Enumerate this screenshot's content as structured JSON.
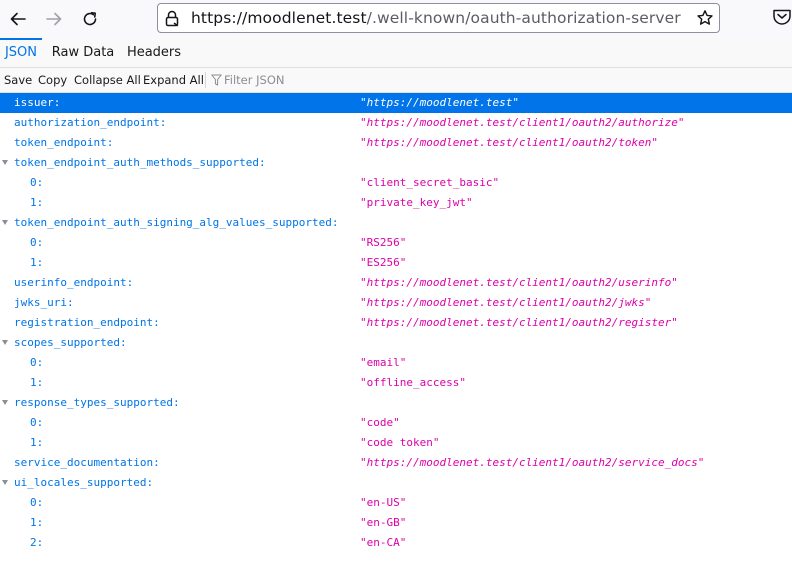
{
  "browser": {
    "url_host": "https://moodlenet.test",
    "url_path": "/.well-known/oauth-authorization-server"
  },
  "tabs": [
    {
      "label": "JSON"
    },
    {
      "label": "Raw Data"
    },
    {
      "label": "Headers"
    }
  ],
  "toolbar": {
    "save_label": "Save",
    "copy_label": "Copy",
    "collapse_label": "Collapse All",
    "expand_label": "Expand All",
    "filter_placeholder": "Filter JSON"
  },
  "rows": [
    {
      "key": "issuer:",
      "value": "\"https://moodlenet.test\"",
      "depth": 0,
      "url": true,
      "selected": true
    },
    {
      "key": "authorization_endpoint:",
      "value": "\"https://moodlenet.test/client1/oauth2/authorize\"",
      "depth": 0,
      "url": true
    },
    {
      "key": "token_endpoint:",
      "value": "\"https://moodlenet.test/client1/oauth2/token\"",
      "depth": 0,
      "url": true
    },
    {
      "key": "token_endpoint_auth_methods_supported:",
      "depth": 0,
      "expandable": true
    },
    {
      "key": "0:",
      "value": "\"client_secret_basic\"",
      "depth": 1
    },
    {
      "key": "1:",
      "value": "\"private_key_jwt\"",
      "depth": 1
    },
    {
      "key": "token_endpoint_auth_signing_alg_values_supported:",
      "depth": 0,
      "expandable": true
    },
    {
      "key": "0:",
      "value": "\"RS256\"",
      "depth": 1
    },
    {
      "key": "1:",
      "value": "\"ES256\"",
      "depth": 1
    },
    {
      "key": "userinfo_endpoint:",
      "value": "\"https://moodlenet.test/client1/oauth2/userinfo\"",
      "depth": 0,
      "url": true
    },
    {
      "key": "jwks_uri:",
      "value": "\"https://moodlenet.test/client1/oauth2/jwks\"",
      "depth": 0,
      "url": true
    },
    {
      "key": "registration_endpoint:",
      "value": "\"https://moodlenet.test/client1/oauth2/register\"",
      "depth": 0,
      "url": true
    },
    {
      "key": "scopes_supported:",
      "depth": 0,
      "expandable": true
    },
    {
      "key": "0:",
      "value": "\"email\"",
      "depth": 1
    },
    {
      "key": "1:",
      "value": "\"offline_access\"",
      "depth": 1
    },
    {
      "key": "response_types_supported:",
      "depth": 0,
      "expandable": true
    },
    {
      "key": "0:",
      "value": "\"code\"",
      "depth": 1
    },
    {
      "key": "1:",
      "value": "\"code token\"",
      "depth": 1
    },
    {
      "key": "service_documentation:",
      "value": "\"https://moodlenet.test/client1/oauth2/service_docs\"",
      "depth": 0,
      "url": true
    },
    {
      "key": "ui_locales_supported:",
      "depth": 0,
      "expandable": true
    },
    {
      "key": "0:",
      "value": "\"en-US\"",
      "depth": 1
    },
    {
      "key": "1:",
      "value": "\"en-GB\"",
      "depth": 1
    },
    {
      "key": "2:",
      "value": "\"en-CA\"",
      "depth": 1
    }
  ]
}
